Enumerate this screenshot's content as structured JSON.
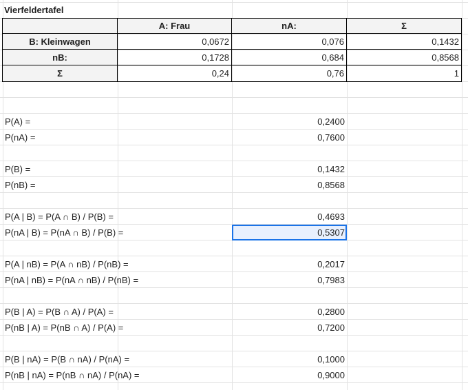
{
  "sheet": {
    "title": "Vierfeldertafel",
    "table": {
      "headers": [
        "",
        "A: Frau",
        "nA:",
        "Σ"
      ],
      "rows": [
        [
          "B: Kleinwagen",
          "0,0672",
          "0,076",
          "0,1432"
        ],
        [
          "nB:",
          "0,1728",
          "0,684",
          "0,8568"
        ],
        [
          "Σ",
          "0,24",
          "0,76",
          "1"
        ]
      ]
    },
    "results": [
      {
        "label": "P(A) =",
        "value": "0,2400"
      },
      {
        "label": "P(nA) =",
        "value": "0,7600"
      },
      {
        "label": "P(B) =",
        "value": "0,1432"
      },
      {
        "label": "P(nB) =",
        "value": "0,8568"
      },
      {
        "label": "P(A | B) = P(A ∩ B) / P(B) =",
        "value": "0,4693"
      },
      {
        "label": "P(nA | B) = P(nA ∩ B) / P(B) =",
        "value": "0,5307"
      },
      {
        "label": "P(A | nB) = P(A ∩ nB) / P(nB) =",
        "value": "0,2017"
      },
      {
        "label": "P(nA | nB) = P(nA ∩ nB) / P(nB) =",
        "value": "0,7983"
      },
      {
        "label": "P(B | A) = P(B ∩ A) / P(A) =",
        "value": "0,2800"
      },
      {
        "label": "P(nB | A) = P(nB ∩ A) / P(A) =",
        "value": "0,7200"
      },
      {
        "label": "P(B | nA) = P(B ∩ nA) / P(nA) =",
        "value": "0,1000"
      },
      {
        "label": "P(nB | nA) = P(nB ∩ nA) / P(nA) =",
        "value": "0,9000"
      }
    ]
  }
}
